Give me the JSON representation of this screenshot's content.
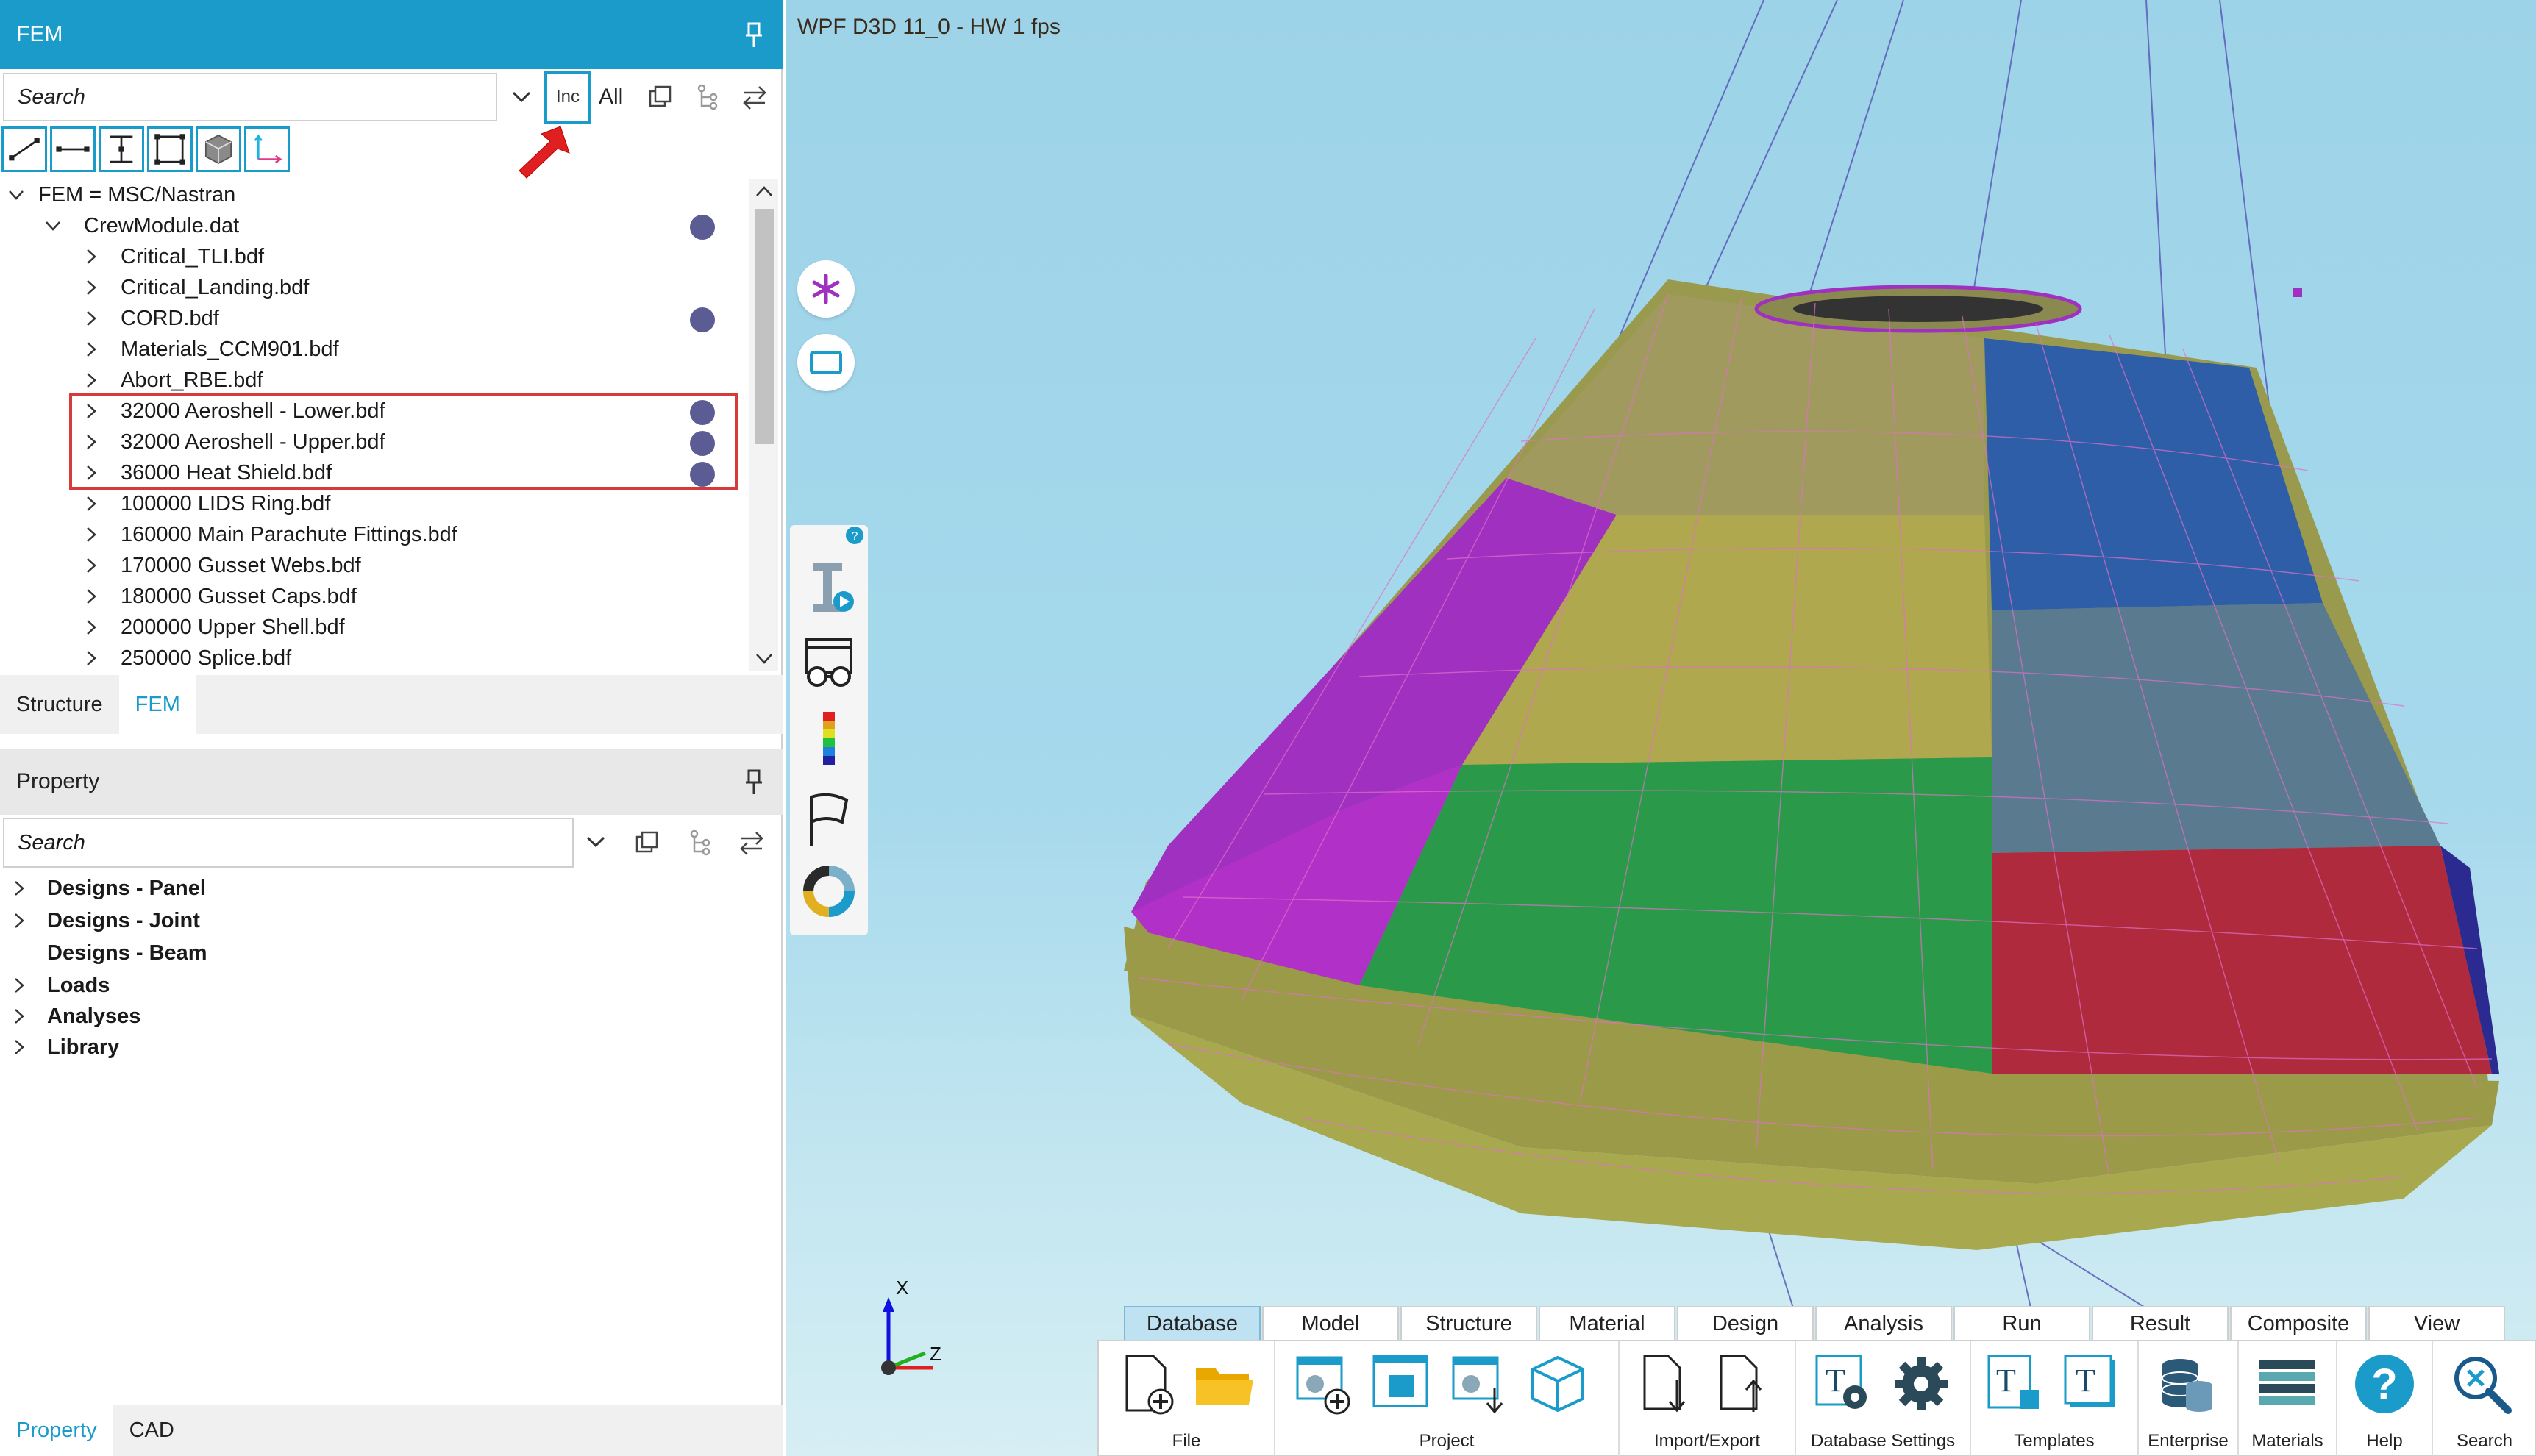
{
  "fem_panel": {
    "title": "FEM",
    "search_placeholder": "Search",
    "inc_label": "Inc",
    "all_label": "All",
    "tree": {
      "root": "FEM = MSC/Nastran",
      "model_file": "CrewModule.dat",
      "files": [
        "Critical_TLI.bdf",
        "Critical_Landing.bdf",
        "CORD.bdf",
        "Materials_CCM901.bdf",
        "Abort_RBE.bdf",
        "32000 Aeroshell - Lower.bdf",
        "32000 Aeroshell - Upper.bdf",
        "36000 Heat Shield.bdf",
        "100000 LIDS Ring.bdf",
        "160000 Main Parachute Fittings.bdf",
        "170000 Gusset Webs.bdf",
        "180000 Gusset Caps.bdf",
        "200000 Upper Shell.bdf",
        "250000 Splice.bdf"
      ]
    },
    "tabs": [
      "Structure",
      "FEM"
    ]
  },
  "property_panel": {
    "title": "Property",
    "search_placeholder": "Search",
    "items": [
      "Designs - Panel",
      "Designs - Joint",
      "Designs - Beam",
      "Loads",
      "Analyses",
      "Library"
    ]
  },
  "bottom_tabs": [
    "Property",
    "CAD"
  ],
  "viewport": {
    "title": "WPF D3D 11_0 - HW  1 fps",
    "axis_x": "X",
    "axis_z": "Z"
  },
  "ribbon": {
    "tabs": [
      "Database",
      "Model",
      "Structure",
      "Material",
      "Design",
      "Analysis",
      "Run",
      "Result",
      "Composite",
      "View"
    ],
    "groups": [
      "File",
      "Project",
      "Import/Export",
      "Database Settings",
      "Templates",
      "Enterprise",
      "Materials",
      "Help",
      "Search"
    ]
  },
  "colors": {
    "accent": "#1a9bc9",
    "highlight": "#d63a3a",
    "status_dot": "#5c5c94"
  }
}
